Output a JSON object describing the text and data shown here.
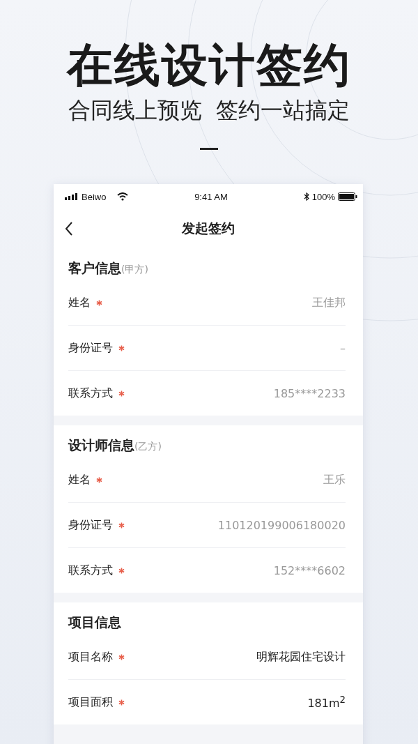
{
  "headline": "在线设计签约",
  "subtitle": "合同线上预览  签约一站搞定",
  "status_bar": {
    "carrier": "Beiwo",
    "time": "9:41 AM",
    "battery": "100%"
  },
  "nav": {
    "title": "发起签约"
  },
  "sections": [
    {
      "title": "客户信息",
      "note": "(甲方)",
      "rows": [
        {
          "label": "姓名",
          "required": true,
          "value": "王佳邦",
          "readonly": true
        },
        {
          "label": "身份证号",
          "required": true,
          "value": "–",
          "readonly": true
        },
        {
          "label": "联系方式",
          "required": true,
          "value": "185****2233",
          "readonly": true
        }
      ]
    },
    {
      "title": "设计师信息",
      "note": "(乙方)",
      "rows": [
        {
          "label": "姓名",
          "required": true,
          "value": "王乐",
          "readonly": true
        },
        {
          "label": "身份证号",
          "required": true,
          "value": "110120199006180020",
          "readonly": true
        },
        {
          "label": "联系方式",
          "required": true,
          "value": "152****6602",
          "readonly": true
        }
      ]
    },
    {
      "title": "项目信息",
      "rows": [
        {
          "label": "项目名称",
          "required": true,
          "value": "明辉花园住宅设计",
          "readonly": false
        },
        {
          "label": "项目面积",
          "required": true,
          "value": "181m$^{2}$",
          "readonly": false
        }
      ]
    }
  ]
}
